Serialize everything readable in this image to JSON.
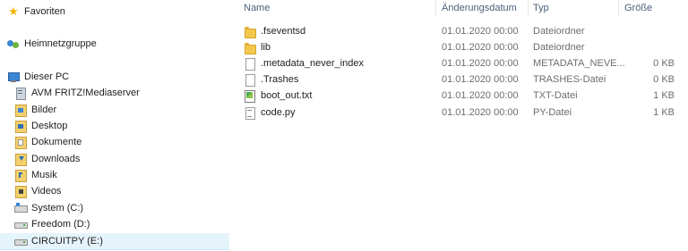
{
  "navigation": {
    "items": [
      {
        "label": "Favoriten",
        "icon": "star-icon",
        "name": "nav-favoriten"
      },
      {
        "label": "Heimnetzgruppe",
        "icon": "homegroup-icon",
        "name": "nav-heimnetzgruppe"
      },
      {
        "label": "Dieser PC",
        "icon": "computer-icon",
        "name": "nav-dieser-pc"
      },
      {
        "label": "AVM FRITZ!Mediaserver",
        "icon": "media-server-icon",
        "name": "nav-avm-fritz-mediaserver"
      },
      {
        "label": "Bilder",
        "icon": "pictures-library-icon",
        "name": "nav-bilder"
      },
      {
        "label": "Desktop",
        "icon": "desktop-library-icon",
        "name": "nav-desktop"
      },
      {
        "label": "Dokumente",
        "icon": "documents-library-icon",
        "name": "nav-dokumente"
      },
      {
        "label": "Downloads",
        "icon": "downloads-library-icon",
        "name": "nav-downloads"
      },
      {
        "label": "Musik",
        "icon": "music-library-icon",
        "name": "nav-musik"
      },
      {
        "label": "Videos",
        "icon": "videos-library-icon",
        "name": "nav-videos"
      },
      {
        "label": "System (C:)",
        "icon": "system-drive-icon",
        "name": "nav-system-c"
      },
      {
        "label": "Freedom (D:)",
        "icon": "drive-icon",
        "name": "nav-freedom-d"
      },
      {
        "label": "CIRCUITPY (E:)",
        "icon": "usb-drive-icon",
        "name": "nav-circuitpy-e",
        "selected": true
      }
    ]
  },
  "columns": {
    "name": "Name",
    "date": "Änderungsdatum",
    "type": "Typ",
    "size": "Größe"
  },
  "files": [
    {
      "name": ".fseventsd",
      "date": "01.01.2020 00:00",
      "type": "Dateiordner",
      "size": "",
      "icon": "folder-icon"
    },
    {
      "name": "lib",
      "date": "01.01.2020 00:00",
      "type": "Dateiordner",
      "size": "",
      "icon": "folder-icon"
    },
    {
      "name": ".metadata_never_index",
      "date": "01.01.2020 00:00",
      "type": "METADATA_NEVE...",
      "size": "0 KB",
      "icon": "file-icon"
    },
    {
      "name": ".Trashes",
      "date": "01.01.2020 00:00",
      "type": "TRASHES-Datei",
      "size": "0 KB",
      "icon": "file-icon"
    },
    {
      "name": "boot_out.txt",
      "date": "01.01.2020 00:00",
      "type": "TXT-Datei",
      "size": "1 KB",
      "icon": "text-file-icon"
    },
    {
      "name": "code.py",
      "date": "01.01.2020 00:00",
      "type": "PY-Datei",
      "size": "1 KB",
      "icon": "python-file-icon"
    }
  ],
  "colors": {
    "selection_background": "#e5f3fb",
    "header_text": "#4c607a"
  }
}
